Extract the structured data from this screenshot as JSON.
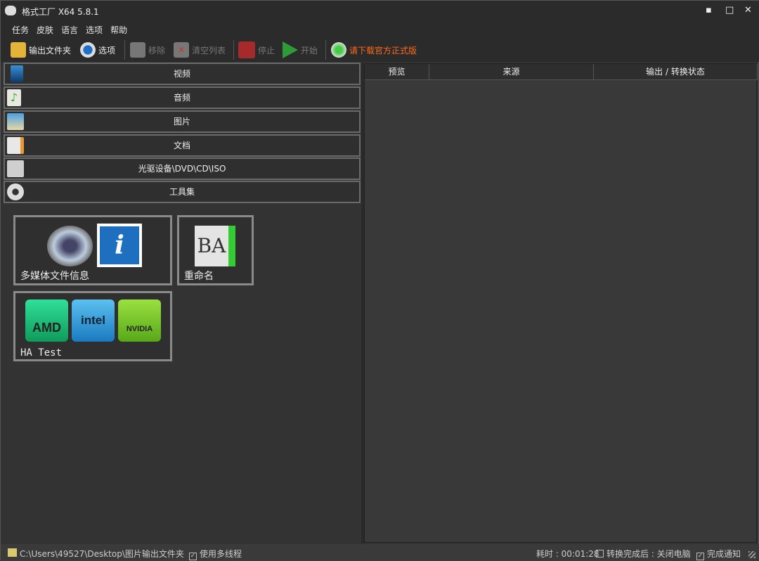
{
  "window": {
    "title": "格式工厂 X64 5.8.1",
    "minimize": "▪",
    "maximize": "□",
    "close": "✕"
  },
  "menu": [
    "任务",
    "皮肤",
    "语言",
    "选项",
    "帮助"
  ],
  "toolbar": {
    "output_folder": "输出文件夹",
    "options": "选项",
    "remove": "移除",
    "clear_list": "清空列表",
    "stop": "停止",
    "start": "开始",
    "download": "请下载官方正式版",
    "download_color": "#ff6a1a"
  },
  "categories": [
    "视频",
    "音频",
    "图片",
    "文档",
    "光驱设备\\DVD\\CD\\ISO",
    "工具集"
  ],
  "tools": {
    "media_info": "多媒体文件信息",
    "rename": "重命名",
    "ha_test": "HA Test",
    "amd": "AMD",
    "intel": "intel",
    "nvidia": "NVIDIA",
    "info_i": "i",
    "rename_glyph": "BA"
  },
  "table": {
    "headers": [
      "预览",
      "来源",
      "输出 / 转换状态"
    ]
  },
  "status": {
    "path": "C:\\Users\\49527\\Desktop\\图片输出文件夹",
    "multithread": "使用多线程",
    "multithread_checked": true,
    "elapsed": "耗时 : 00:01:28",
    "after_done": "转换完成后 : 关闭电脑",
    "after_done_checked": false,
    "notify": "完成通知",
    "notify_checked": true
  }
}
